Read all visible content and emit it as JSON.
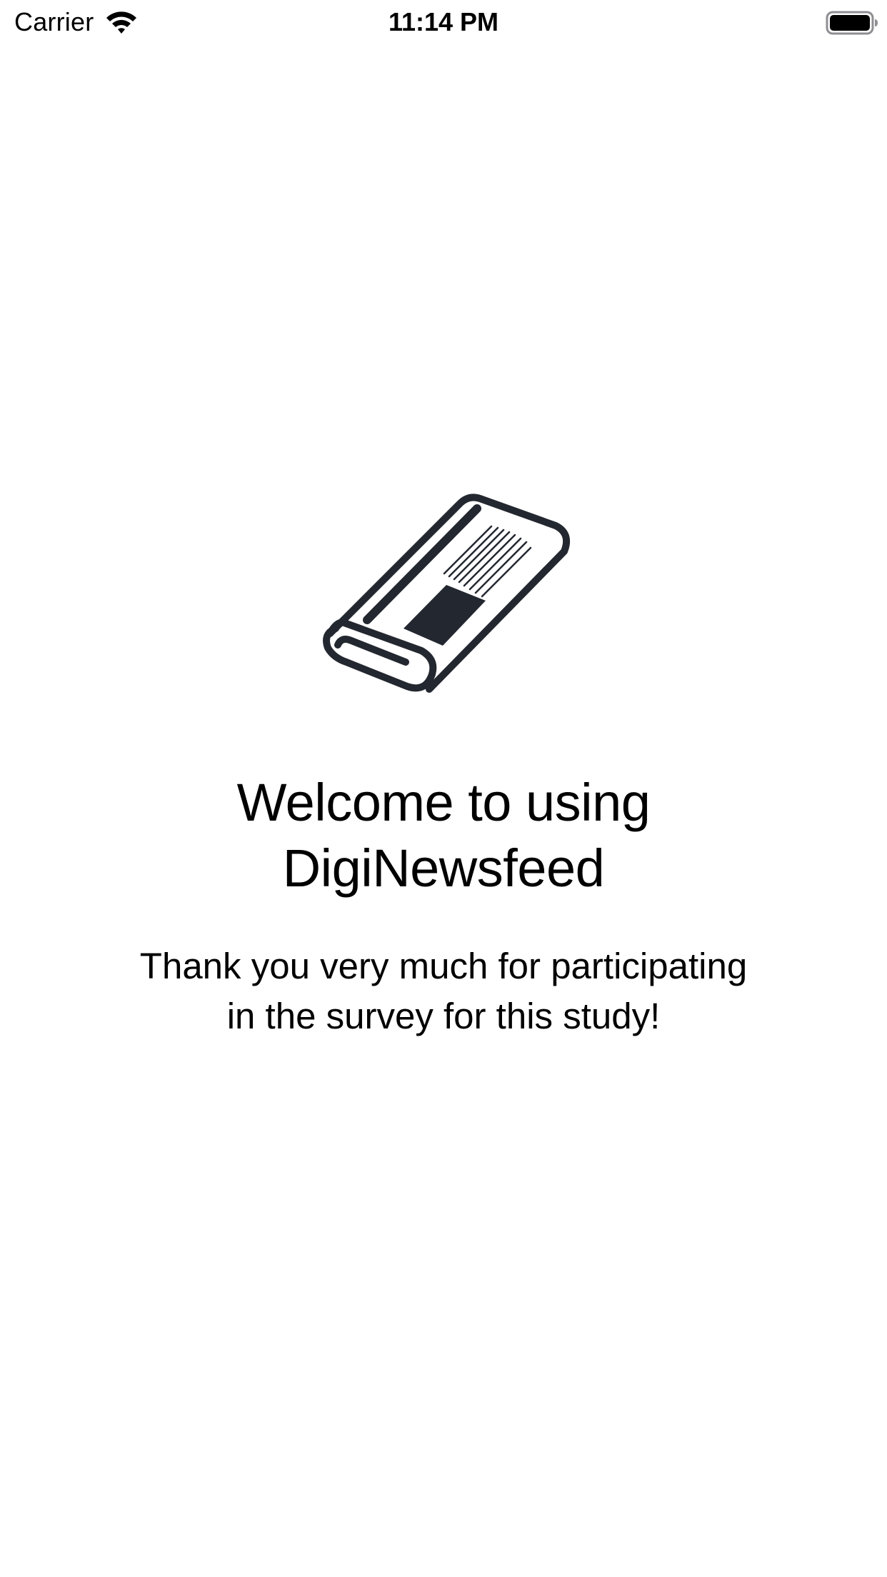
{
  "status_bar": {
    "carrier": "Carrier",
    "time": "11:14 PM",
    "wifi_icon": "wifi-icon",
    "battery_icon": "battery-full-icon"
  },
  "welcome": {
    "icon": "newspaper-icon",
    "icon_color": "#23272f",
    "title": "Welcome to using DigiNewsfeed",
    "message": "Thank you very much for participating in the survey for this study!"
  }
}
